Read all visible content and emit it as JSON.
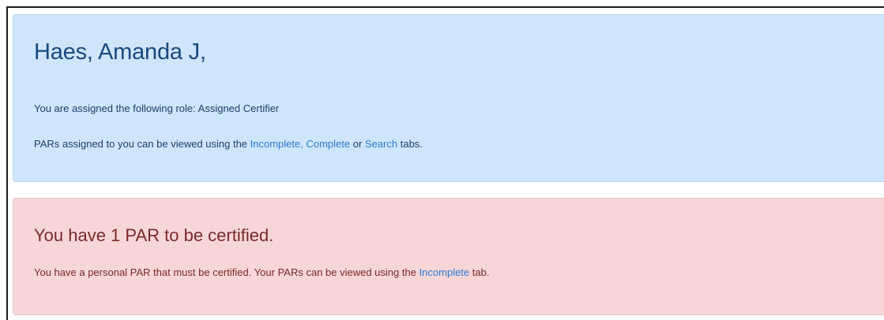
{
  "welcome": {
    "name": "Haes, Amanda J,",
    "role_text": "You are assigned the following role: Assigned Certifier",
    "pars_prefix": "PARs assigned to you can be viewed using the ",
    "link_incomplete": "Incomplete,",
    "space": " ",
    "link_complete": "Complete",
    "or_text": " or ",
    "link_search": "Search",
    "pars_suffix": " tabs."
  },
  "notice": {
    "title": "You have 1 PAR to be certified.",
    "message_prefix": "You have a personal PAR that must be certified. Your PARs can be viewed using the ",
    "link_incomplete": "Incomplete",
    "message_suffix": " tab."
  },
  "colors": {
    "info_background": "#cfe5fb",
    "danger_background": "#f7d6d8",
    "link": "#2c7bd3"
  }
}
